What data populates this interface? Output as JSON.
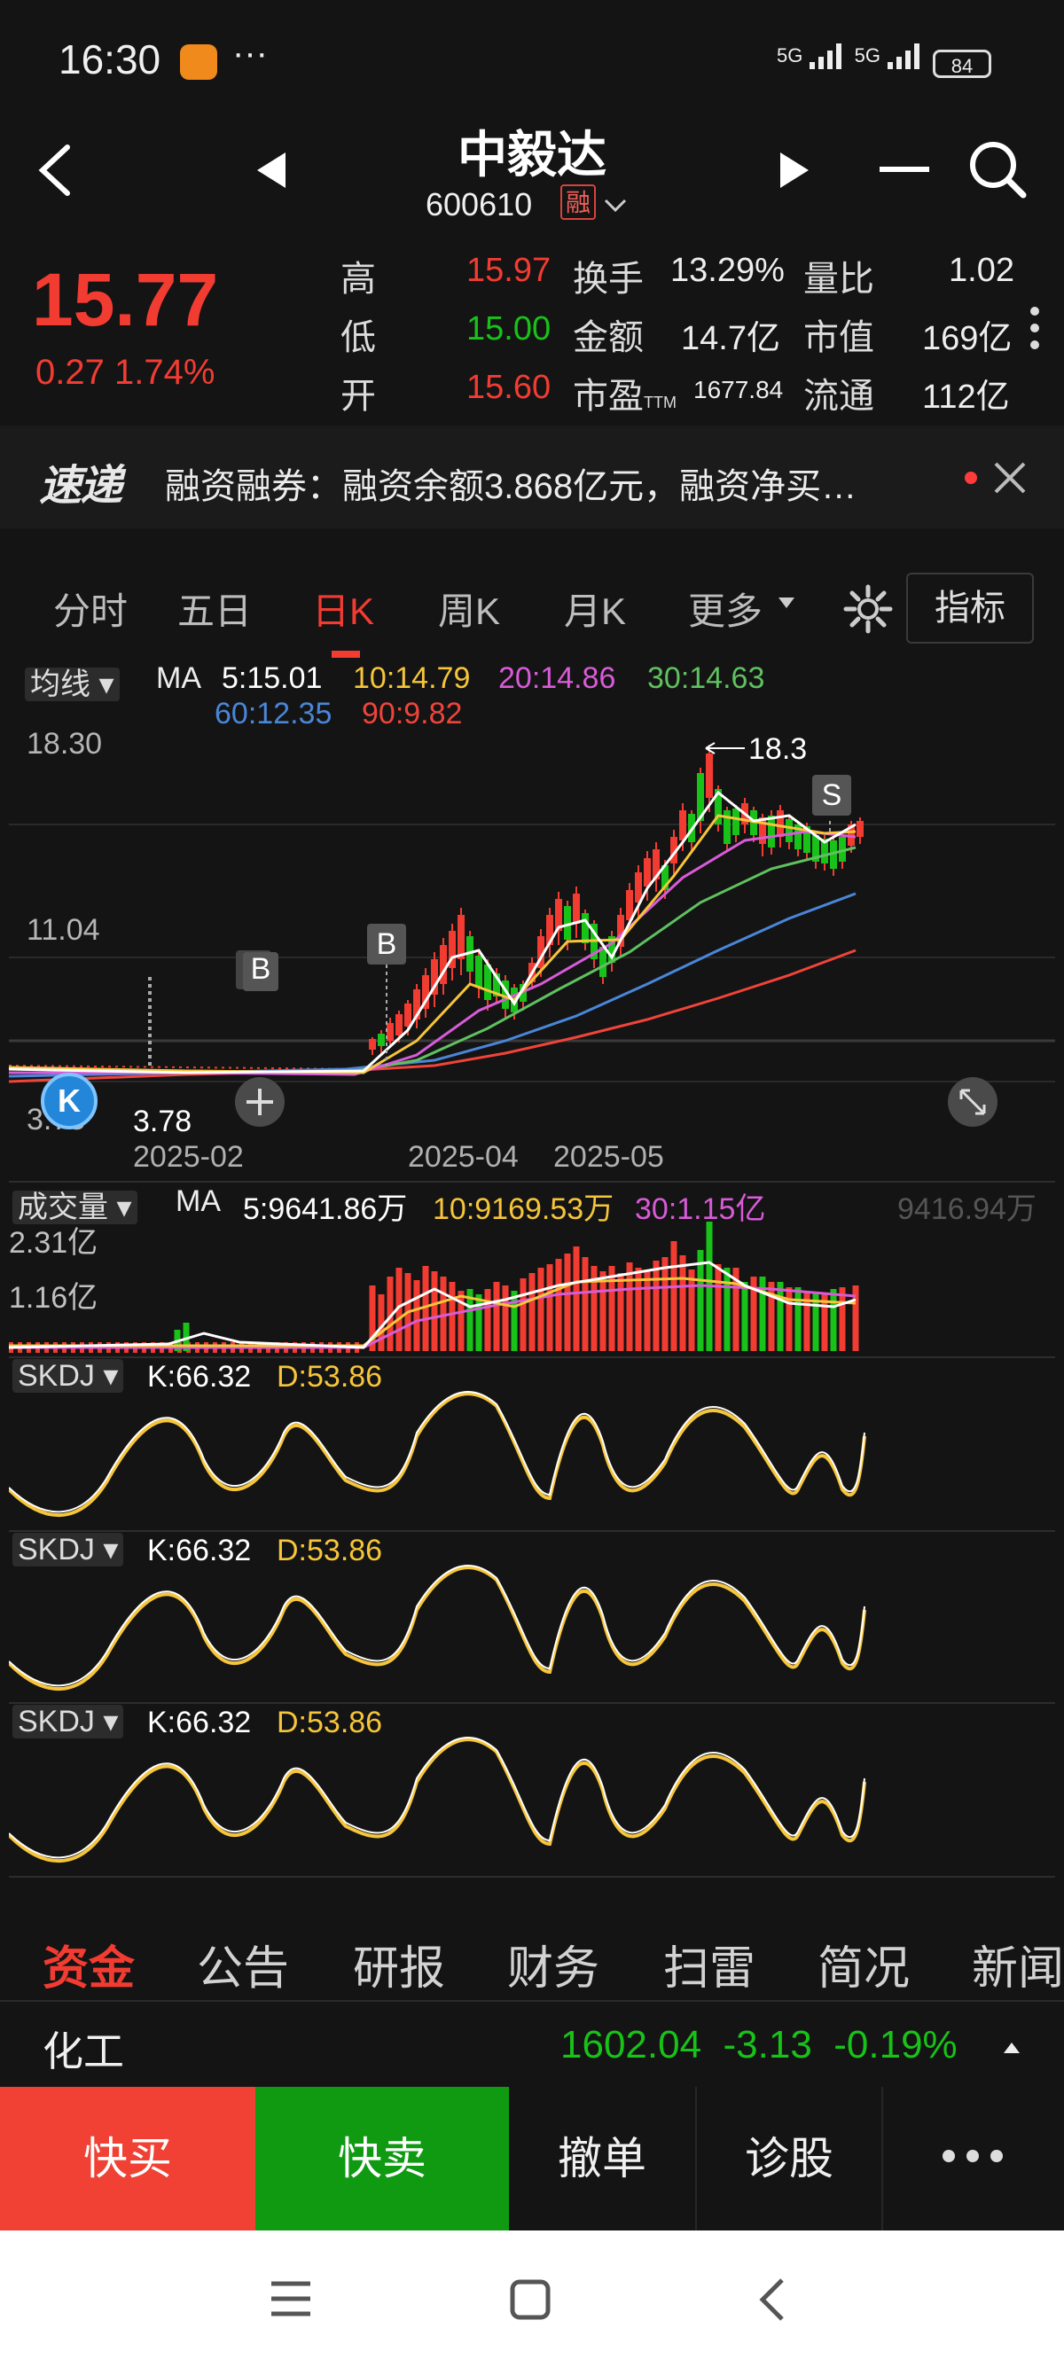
{
  "status_bar": {
    "time": "16:30",
    "dots": "···",
    "signal_1": "5G",
    "signal_2": "5G",
    "battery": "84"
  },
  "header": {
    "name": "中毅达",
    "code": "600610",
    "margin_badge": "融"
  },
  "quote": {
    "price": "15.77",
    "change": "0.27",
    "change_pct": "1.74%",
    "rows": [
      [
        {
          "label": "高",
          "value": "15.97",
          "color": "red"
        },
        {
          "label": "换手",
          "value": "13.29%"
        },
        {
          "label": "量比",
          "value": "1.02"
        }
      ],
      [
        {
          "label": "低",
          "value": "15.00",
          "color": "green"
        },
        {
          "label": "金额",
          "value": "14.7亿"
        },
        {
          "label": "市值",
          "value": "169亿"
        }
      ],
      [
        {
          "label": "开",
          "value": "15.60",
          "color": "red"
        },
        {
          "label": "市盈",
          "sub": "TTM",
          "value": "1677.84"
        },
        {
          "label": "流通",
          "value": "112亿"
        }
      ]
    ]
  },
  "ticker": {
    "logo": "速递",
    "text": "融资融券：融资余额3.868亿元，融资净买…"
  },
  "chart_tabs": [
    "分时",
    "五日",
    "日K",
    "周K",
    "月K",
    "更多"
  ],
  "indicator_label": "指标",
  "kline": {
    "ma_menu": "均线",
    "ma_title": "MA",
    "ma_items": [
      {
        "label": "5:15.01",
        "color": "#ffffff"
      },
      {
        "label": "10:14.79",
        "color": "#f6c53a"
      },
      {
        "label": "20:14.86",
        "color": "#d85bd8"
      },
      {
        "label": "30:14.63",
        "color": "#5fc15f"
      },
      {
        "label": "60:12.35",
        "color": "#4a86d8"
      },
      {
        "label": "90:9.82",
        "color": "#f0443a"
      }
    ],
    "y_top": "18.30",
    "y_mid": "11.04",
    "y_low": "3.78",
    "low_label": "3.78",
    "high_label": "18.3",
    "x_labels": [
      "2025-02",
      "2025-04",
      "2025-05"
    ],
    "markers": {
      "b1": "B",
      "b2": "B",
      "s": "S",
      "k": "K"
    }
  },
  "volume": {
    "menu": "成交量",
    "ma_title": "MA",
    "items": [
      {
        "label": "5:9641.86万",
        "color": "#ffffff"
      },
      {
        "label": "10:9169.53万",
        "color": "#f6c53a"
      },
      {
        "label": "30:1.15亿",
        "color": "#d85bd8"
      }
    ],
    "right_value": "9416.94万",
    "y_top": "2.31亿",
    "y_mid": "1.16亿"
  },
  "skdj_panels": [
    {
      "name": "SKDJ",
      "k": "K:66.32",
      "d": "D:53.86"
    },
    {
      "name": "SKDJ",
      "k": "K:66.32",
      "d": "D:53.86"
    },
    {
      "name": "SKDJ",
      "k": "K:66.32",
      "d": "D:53.86"
    }
  ],
  "info_tabs": [
    "资金",
    "公告",
    "研报",
    "财务",
    "扫雷",
    "简况",
    "新闻"
  ],
  "sector": {
    "name": "化工",
    "value": "1602.04",
    "change": "-3.13",
    "pct": "-0.19%"
  },
  "actions": {
    "buy": "快买",
    "sell": "快卖",
    "cancel": "撤单",
    "diagnose": "诊股"
  },
  "colors": {
    "up": "#f23c32",
    "down": "#18c218",
    "background": "#141414"
  }
}
